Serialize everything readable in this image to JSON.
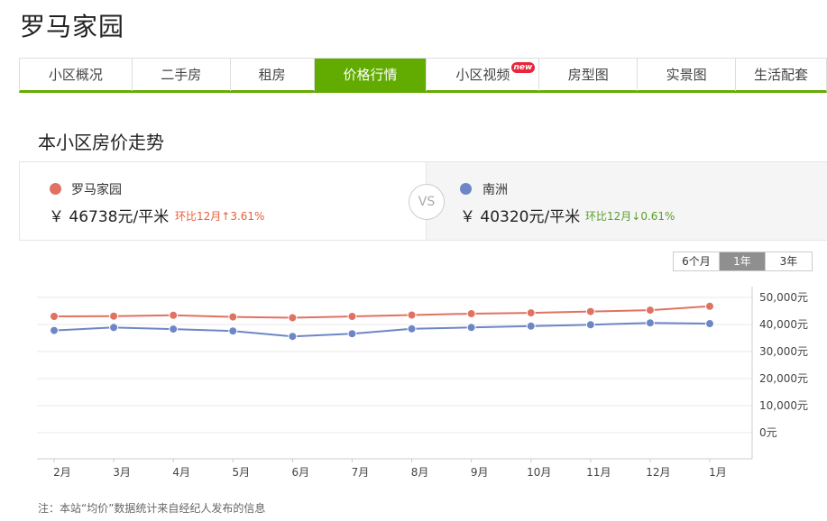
{
  "page": {
    "title": "罗马家园"
  },
  "tabs": [
    {
      "label": "小区概况",
      "active": false,
      "badge": ""
    },
    {
      "label": "二手房",
      "active": false,
      "badge": ""
    },
    {
      "label": "租房",
      "active": false,
      "badge": ""
    },
    {
      "label": "价格行情",
      "active": true,
      "badge": ""
    },
    {
      "label": "小区视频",
      "active": false,
      "badge": "new"
    },
    {
      "label": "房型图",
      "active": false,
      "badge": ""
    },
    {
      "label": "实景图",
      "active": false,
      "badge": ""
    },
    {
      "label": "生活配套",
      "active": false,
      "badge": ""
    }
  ],
  "section": {
    "title": "本小区房价走势"
  },
  "compare": {
    "left": {
      "name": "罗马家园",
      "price": "￥ 46738元/平米",
      "change": "环比12月↑3.61%",
      "color": "#e07262",
      "change_color": "#e8603c"
    },
    "vs": "VS",
    "right": {
      "name": "南洲",
      "price": "￥ 40320元/平米",
      "change": "环比12月↓0.61%",
      "color": "#6d86c6",
      "change_color": "#5aa02c"
    }
  },
  "range": {
    "options": [
      "6个月",
      "1年",
      "3年"
    ],
    "selected": 1
  },
  "chart_data": {
    "type": "line",
    "categories": [
      "2月",
      "3月",
      "4月",
      "5月",
      "6月",
      "7月",
      "8月",
      "9月",
      "10月",
      "11月",
      "12月",
      "1月"
    ],
    "series": [
      {
        "name": "罗马家园",
        "color": "#e07262",
        "values": [
          43000,
          43100,
          43400,
          42800,
          42500,
          43000,
          43500,
          44000,
          44300,
          44800,
          45300,
          46738
        ]
      },
      {
        "name": "南洲",
        "color": "#6d86c6",
        "values": [
          37800,
          38900,
          38300,
          37600,
          35600,
          36600,
          38400,
          38900,
          39400,
          39900,
          40600,
          40320
        ]
      }
    ],
    "y_ticks": [
      "50,000元",
      "40,000元",
      "30,000元",
      "20,000元",
      "10,000元",
      "0元"
    ],
    "ylim": [
      0,
      50000
    ],
    "grid": true
  },
  "footnote": "注：本站“均价”数据统计来自经纪人发布的信息"
}
